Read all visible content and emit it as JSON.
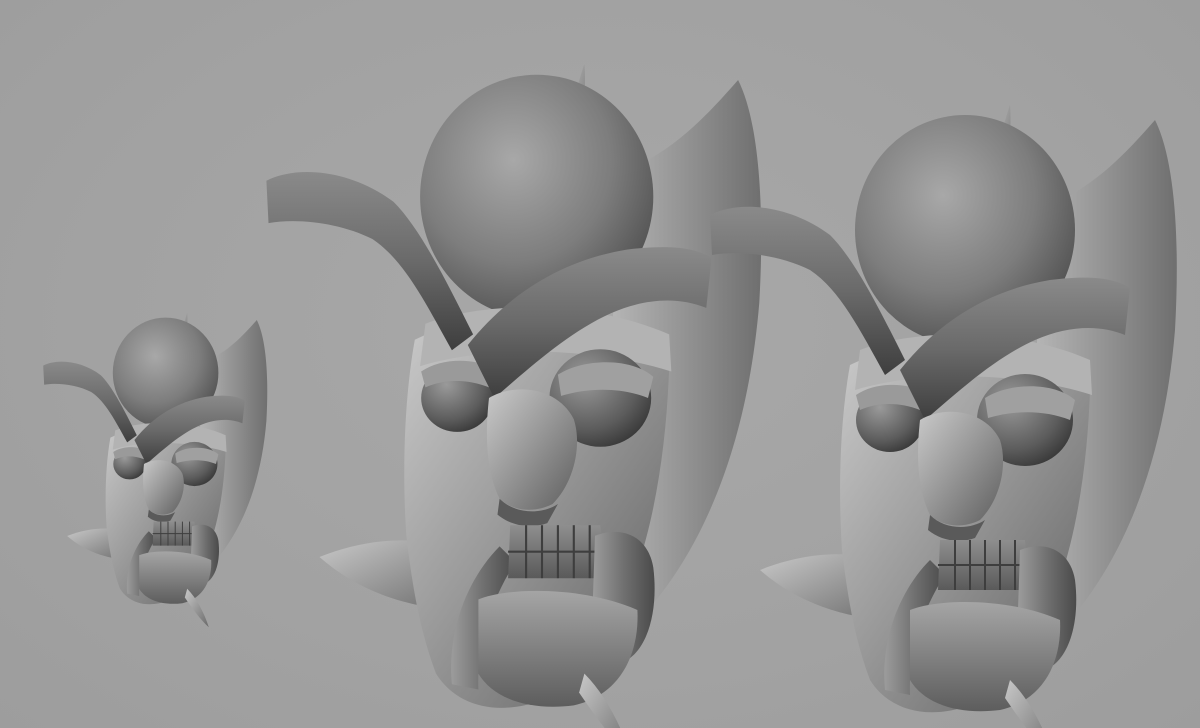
{
  "scene": {
    "background_color": "#a3a3a3",
    "material_color": "#7c7c7c",
    "objects": [
      {
        "name": "small-demon-mask",
        "icon": "mask-sculpt"
      },
      {
        "name": "large-demon-mask",
        "icon": "mask-sculpt"
      },
      {
        "name": "detailed-demon-mask",
        "icon": "mask-sculpt"
      }
    ]
  }
}
